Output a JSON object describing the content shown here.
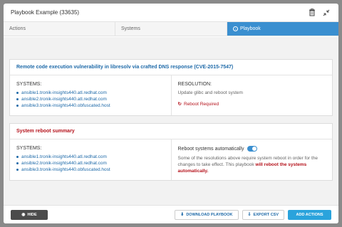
{
  "header": {
    "title": "Playbook Example (33635)"
  },
  "tabs": [
    {
      "label": "Actions"
    },
    {
      "label": "Systems"
    },
    {
      "label": "Playbook"
    }
  ],
  "card1": {
    "title": "Remote code execution vulnerability in libresolv via crafted DNS response (CVE-2015-7547)",
    "systems_label": "SYSTEMS:",
    "hosts": [
      "ansible1.tronik-insights440.atl.redhat.com",
      "ansible2.tronik-insights440.atl.redhat.com",
      "ansible3.tronik-insights440.obfuscated.host"
    ],
    "resolution_label": "RESOLUTION:",
    "resolution_text": "Update glibc and reboot system",
    "reboot_required": "Reboot Required"
  },
  "card2": {
    "title": "System reboot summary",
    "systems_label": "SYSTEMS:",
    "hosts": [
      "ansible1.tronik-insights440.atl.redhat.com",
      "ansible2.tronik-insights440.atl.redhat.com",
      "ansible3.tronik-insights440.obfuscated.host"
    ],
    "toggle_label": "Reboot systems automatically",
    "desc_text": "Some of the resolutions above require system reboot in order for the changes to take effect. This playbook ",
    "desc_strong": "will reboot the systems automatically."
  },
  "footer": {
    "hide_label": "HIDE",
    "download_label": "DOWNLOAD PLAYBOOK",
    "export_label": "EXPORT CSV",
    "add_label": "ADD ACTIONS"
  },
  "colors": {
    "accent": "#3a8fd0",
    "link": "#1d69a8",
    "danger": "#b5121b",
    "primary_button": "#2aa3dc"
  }
}
